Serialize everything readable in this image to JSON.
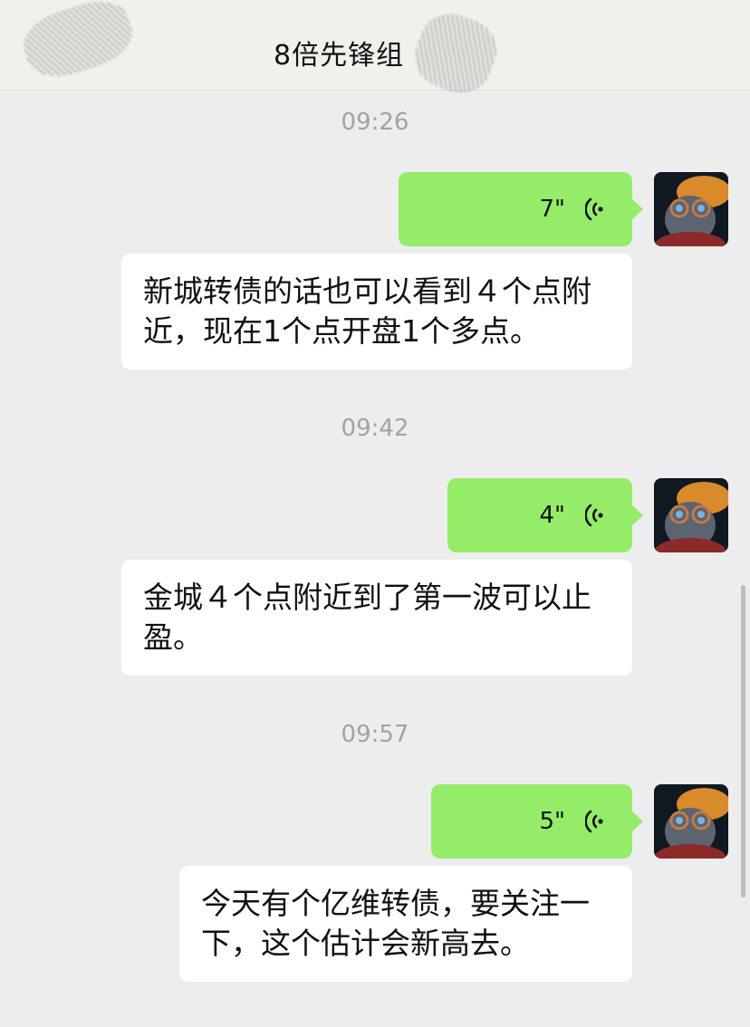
{
  "header": {
    "title": "8倍先锋组"
  },
  "messages": [
    {
      "time": "09:26",
      "voice_duration": "7\"",
      "text": "新城转债的话也可以看到４个点附近，现在1个点开盘1个多点。"
    },
    {
      "time": "09:42",
      "voice_duration": "4\"",
      "text": "金城４个点附近到了第一波可以止盈。"
    },
    {
      "time": "09:57",
      "voice_duration": "5\"",
      "text": "今天有个亿维转债，要关注一下，这个估计会新高去。"
    }
  ],
  "icons": {
    "voice": "voice-wave-icon",
    "avatar": "cat-with-glasses-avatar"
  },
  "colors": {
    "voice_bubble": "#95ec69",
    "text_bubble": "#ffffff",
    "background": "#ededed"
  }
}
